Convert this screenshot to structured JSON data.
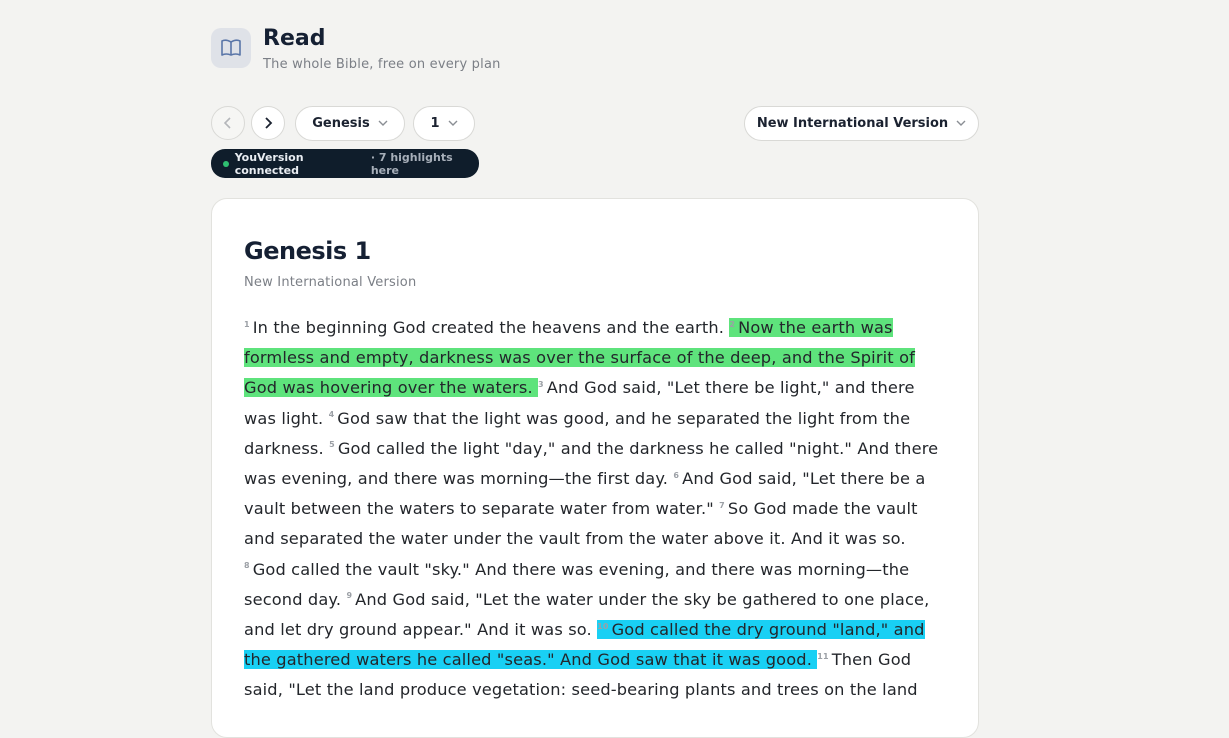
{
  "header": {
    "title": "Read",
    "subtitle": "The whole Bible, free on every plan",
    "icon": "open-book-icon"
  },
  "controls": {
    "prev_icon": "chevron-left-icon",
    "next_icon": "chevron-right-icon",
    "book": "Genesis",
    "chapter": "1",
    "version": "New International Version"
  },
  "status": {
    "label": "YouVersion connected",
    "detail": "· 7 highlights here",
    "color": "#2fbf71"
  },
  "reader": {
    "title": "Genesis 1",
    "version": "New International Version",
    "highlight_colors": {
      "green": "#5ee37c",
      "blue": "#19d0f4"
    },
    "verses": [
      {
        "n": "1",
        "text": "In the beginning God created the heavens and the earth.",
        "highlight": null
      },
      {
        "n": "2",
        "text": "Now the earth was formless and empty, darkness was over the surface of the deep, and the Spirit of God was hovering over the waters.",
        "highlight": "green"
      },
      {
        "n": "3",
        "text": "And God said, \"Let there be light,\" and there was light.",
        "highlight": null
      },
      {
        "n": "4",
        "text": "God saw that the light was good, and he separated the light from the darkness.",
        "highlight": null
      },
      {
        "n": "5",
        "text": "God called the light \"day,\" and the darkness he called \"night.\" And there was evening, and there was morning—the first day.",
        "highlight": null
      },
      {
        "n": "6",
        "text": "And God said, \"Let there be a vault between the waters to separate water from water.\"",
        "highlight": null
      },
      {
        "n": "7",
        "text": "So God made the vault and separated the water under the vault from the water above it. And it was so.",
        "highlight": null
      },
      {
        "n": "8",
        "text": "God called the vault \"sky.\" And there was evening, and there was morning—the second day.",
        "highlight": null
      },
      {
        "n": "9",
        "text": "And God said, \"Let the water under the sky be gathered to one place, and let dry ground appear.\" And it was so.",
        "highlight": null
      },
      {
        "n": "10",
        "text": "God called the dry ground \"land,\" and the gathered waters he called \"seas.\" And God saw that it was good.",
        "highlight": "blue"
      },
      {
        "n": "11",
        "text": "Then God said, \"Let the land produce vegetation: seed-bearing plants and trees on the land",
        "highlight": null
      }
    ]
  }
}
